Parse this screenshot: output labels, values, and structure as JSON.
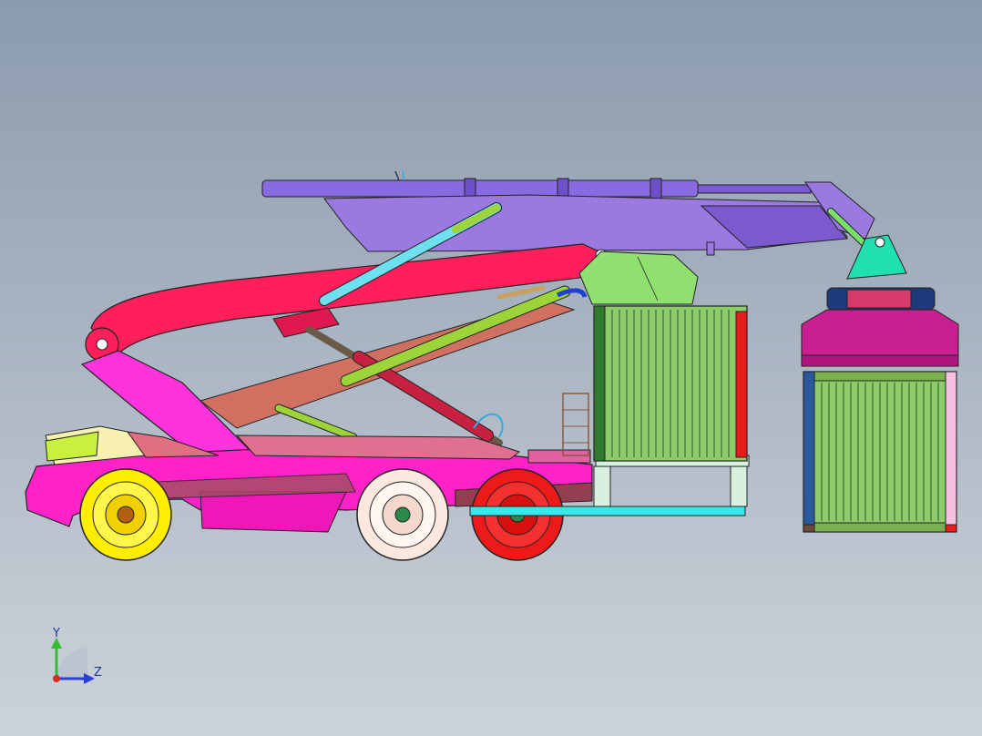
{
  "viewport": {
    "background_top": "#8b9aae",
    "background_bottom": "#cdd3da"
  },
  "triad": {
    "y_label": "Y",
    "z_label": "Z",
    "y_color": "#2fbf2f",
    "z_color": "#2a3fd6",
    "x_color": "#d62a2a"
  },
  "model": {
    "colors": {
      "chassis": "#ff22c8",
      "cab": "#c8f03c",
      "boom_upper": "#9a7ae0",
      "boom_main": "#ff1f5a",
      "boom_support": "#ff33dd",
      "lift_arm": "#d07060",
      "cylinder_cyan": "#6fe0f0",
      "cylinder_red": "#c82040",
      "cylinder_green": "#9cd43a",
      "container": "#8ccc6a",
      "spreader": "#c02090",
      "rear_frame": "#38e8e8",
      "wheel_front": "#ffee00",
      "wheel_mid": "#fde8e0",
      "wheel_rear": "#ee1a1a"
    }
  }
}
